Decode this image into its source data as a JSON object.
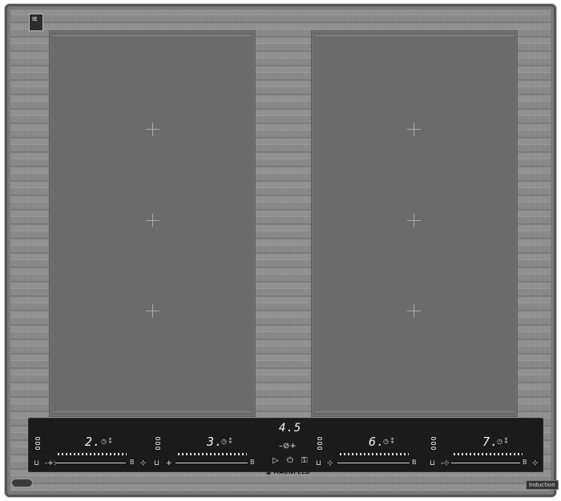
{
  "zones": {
    "left": {
      "name": "left-cooking-zone"
    },
    "right": {
      "name": "right-cooking-zone"
    }
  },
  "control_panel": {
    "timer_display": "4.5",
    "zone_levels": [
      "2.",
      "3.",
      "6.",
      "7."
    ],
    "boost_symbol": "B",
    "power_icon": "power-icon",
    "lock_icon": "lock-icon",
    "play_icon": "play-icon"
  },
  "brand": "MAUNFELD",
  "badge_left": "",
  "induction_label": "Induction",
  "top_label": "IE"
}
